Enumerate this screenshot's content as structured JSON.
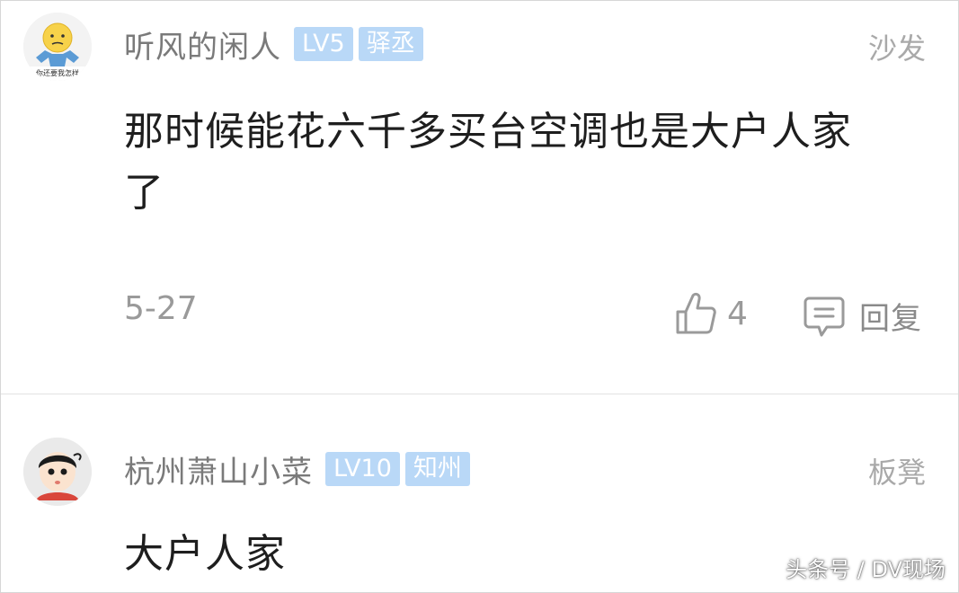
{
  "comments": [
    {
      "username": "听风的闲人",
      "badges": [
        "LV5",
        "驿丞"
      ],
      "rank": "沙发",
      "content": "那时候能花六千多买台空调也是大户人家了",
      "date": "5-27",
      "likes": "4",
      "reply_label": "回复",
      "avatar_icon": "shrug-emoji-avatar",
      "avatar_caption": "你还要我怎样"
    },
    {
      "username": "杭州萧山小菜",
      "badges": [
        "LV10",
        "知州"
      ],
      "rank": "板凳",
      "content": "大户人家",
      "avatar_icon": "cartoon-boy-avatar"
    }
  ],
  "watermark": "头条号 / DV现场",
  "colors": {
    "badge_bg": "#b9d8f7",
    "username": "#7a7a7a",
    "meta_text": "#9a9a9a",
    "divider": "#e3e3e3"
  }
}
